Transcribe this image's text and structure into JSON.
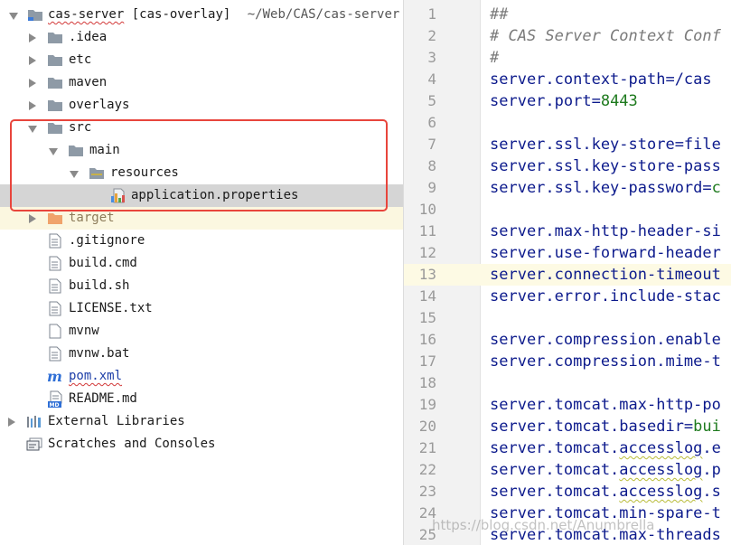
{
  "project_tree": {
    "root": {
      "name": "cas-server",
      "module": "[cas-overlay]",
      "path": "~/Web/CAS/cas-server"
    },
    "items": [
      {
        "label": ".idea"
      },
      {
        "label": "etc"
      },
      {
        "label": "maven"
      },
      {
        "label": "overlays"
      },
      {
        "label": "src"
      },
      {
        "label": "main"
      },
      {
        "label": "resources"
      },
      {
        "label": "application.properties"
      },
      {
        "label": "target"
      },
      {
        "label": ".gitignore"
      },
      {
        "label": "build.cmd"
      },
      {
        "label": "build.sh"
      },
      {
        "label": "LICENSE.txt"
      },
      {
        "label": "mvnw"
      },
      {
        "label": "mvnw.bat"
      },
      {
        "label": "pom.xml"
      },
      {
        "label": "README.md"
      },
      {
        "label": "External Libraries"
      },
      {
        "label": "Scratches and Consoles"
      }
    ],
    "icons": {
      "folder": "folder-icon",
      "file": "file-icon",
      "properties": "properties-file-icon",
      "maven": "maven-icon",
      "markdown": "markdown-icon",
      "libraries": "libraries-icon",
      "scratches": "scratches-icon"
    },
    "colors": {
      "folder": "#8e9aa6",
      "target_folder": "#f0a36b",
      "highlight_border": "#e8453c",
      "selected_row": "#d5d5d5"
    }
  },
  "editor": {
    "line_numbers": [
      "1",
      "2",
      "3",
      "4",
      "5",
      "6",
      "7",
      "8",
      "9",
      "10",
      "11",
      "12",
      "13",
      "14",
      "15",
      "16",
      "17",
      "18",
      "19",
      "20",
      "21",
      "22",
      "23",
      "24",
      "25"
    ],
    "current_line": "13",
    "lines": [
      {
        "key": "##",
        "val": ""
      },
      {
        "key": "# CAS Server Context Conf",
        "val": ""
      },
      {
        "key": "#",
        "val": ""
      },
      {
        "key": "server.context-path=/cas",
        "val": ""
      },
      {
        "key": "server.port=",
        "val": "8443"
      },
      {
        "key": "",
        "val": ""
      },
      {
        "key": "server.ssl.key-store=file",
        "val": ""
      },
      {
        "key": "server.ssl.key-store-pass",
        "val": ""
      },
      {
        "key": "server.ssl.key-password=",
        "val": "c"
      },
      {
        "key": "",
        "val": ""
      },
      {
        "key": "server.max-http-header-si",
        "val": ""
      },
      {
        "key": "server.use-forward-header",
        "val": ""
      },
      {
        "key": "server.connection-timeout",
        "val": ""
      },
      {
        "key": "server.error.include-stac",
        "val": ""
      },
      {
        "key": "",
        "val": ""
      },
      {
        "key": "server.compression.enable",
        "val": ""
      },
      {
        "key": "server.compression.mime-t",
        "val": ""
      },
      {
        "key": "",
        "val": ""
      },
      {
        "key": "server.tomcat.max-http-po",
        "val": ""
      },
      {
        "key": "server.tomcat.basedir=",
        "val": "bui"
      },
      {
        "key": "server.tomcat.",
        "squig": "accesslog",
        "tail": ".e"
      },
      {
        "key": "server.tomcat.",
        "squig": "accesslog",
        "tail": ".p"
      },
      {
        "key": "server.tomcat.",
        "squig": "accesslog",
        "tail": ".s"
      },
      {
        "key": "server.tomcat.min-spare-t",
        "val": ""
      },
      {
        "key": "server.tomcat.max-threads",
        "val": ""
      }
    ],
    "colors": {
      "code": "#0c1a8c",
      "value": "#1e7a1e",
      "comment": "#7a7a7a",
      "current_line_bg": "#fdfae4"
    }
  },
  "watermark": "https://blog.csdn.net/Anumbrella"
}
